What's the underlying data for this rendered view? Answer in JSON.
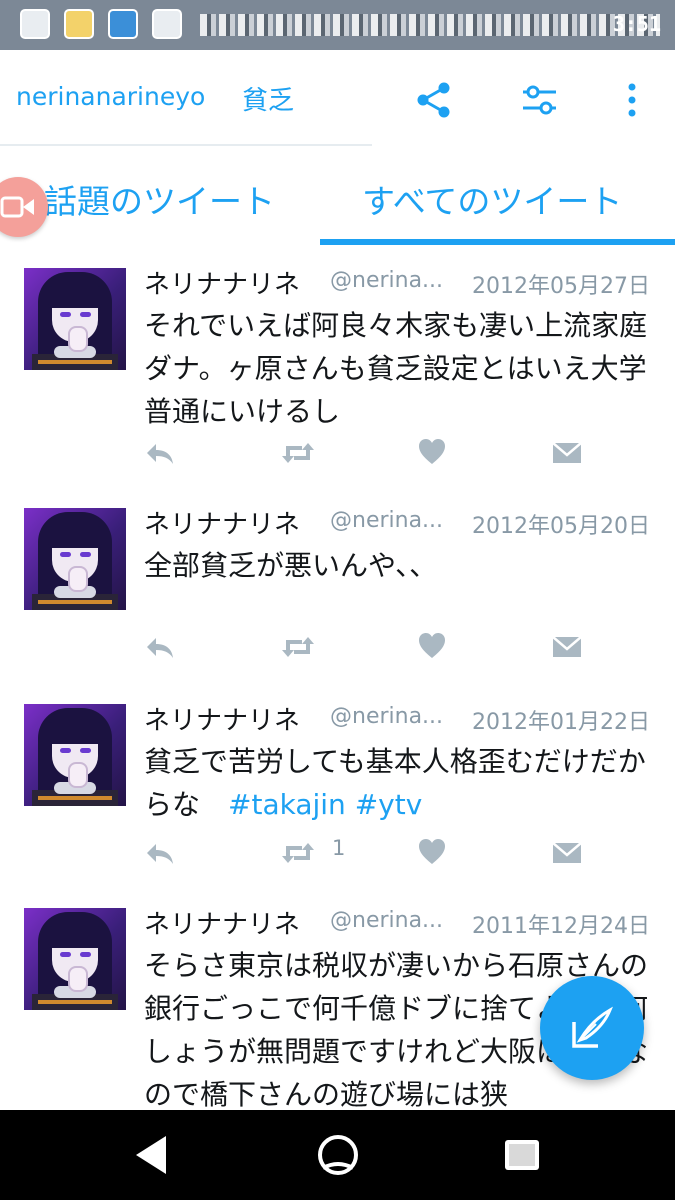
{
  "status_bar": {
    "time": "3:51"
  },
  "header": {
    "username": "nerinanarineyo",
    "search_query": "貧乏"
  },
  "tabs": [
    {
      "label": "話題のツイート",
      "active": false
    },
    {
      "label": "すべてのツイート",
      "active": true
    }
  ],
  "colors": {
    "accent": "#1da1f2",
    "muted": "#8899a6",
    "text": "#14171a",
    "camera_button": "#f4a09a"
  },
  "tweets": [
    {
      "name": "ネリナナリネ",
      "handle": "@nerina...",
      "date": "2012年05月27日",
      "text": "それでいえば阿良々木家も凄い上流家庭ダナ。ヶ原さんも貧乏設定とはいえ大学普通にいけるし",
      "hashtags": "",
      "retweets": ""
    },
    {
      "name": "ネリナナリネ",
      "handle": "@nerina...",
      "date": "2012年05月20日",
      "text": "全部貧乏が悪いんや、、",
      "hashtags": "",
      "retweets": ""
    },
    {
      "name": "ネリナナリネ",
      "handle": "@nerina...",
      "date": "2012年01月22日",
      "text": "貧乏で苦労しても基本人格歪むだけだからな　",
      "hashtags": "#takajin #ytv",
      "retweets": "1"
    },
    {
      "name": "ネリナナリネ",
      "handle": "@nerina...",
      "date": "2011年12月24日",
      "text": "そらさ東京は税収が凄いから石原さんの銀行ごっこで何千億ドブに捨てようが何しょうが無問題ですけれど大阪は貧乏なので橋下さんの遊び場には狭",
      "hashtags": "",
      "retweets": ""
    }
  ]
}
